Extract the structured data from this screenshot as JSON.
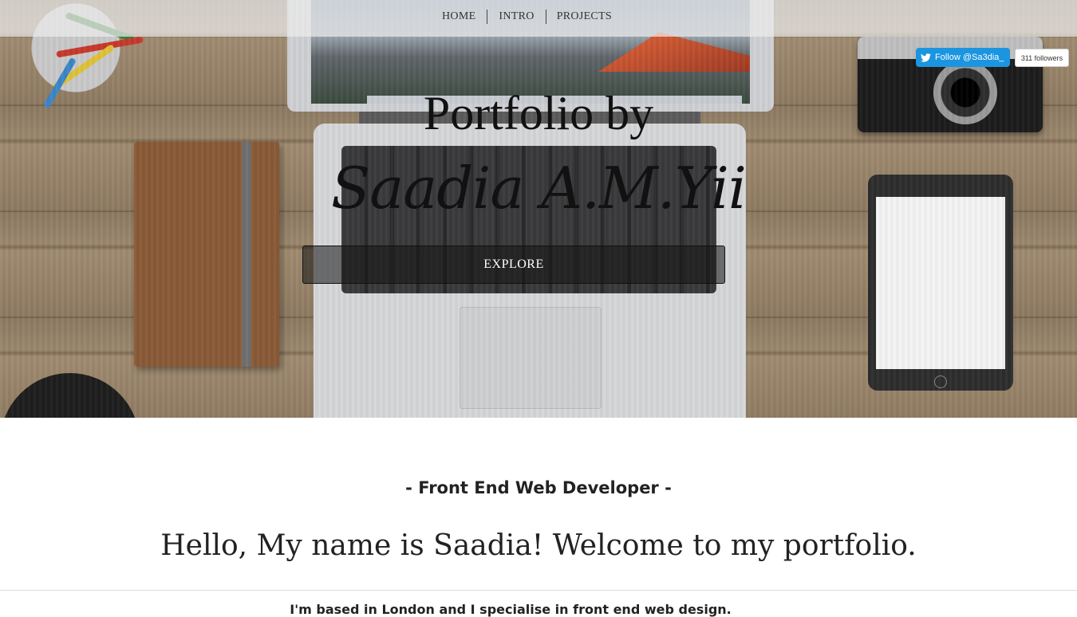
{
  "nav": {
    "items": [
      {
        "label": "HOME"
      },
      {
        "label": "INTRO"
      },
      {
        "label": "PROJECTS"
      }
    ]
  },
  "twitter": {
    "follow_label": "Follow @Sa3dia_",
    "followers_label": "311 followers",
    "brand_color": "#1b95e0"
  },
  "hero": {
    "title_line1": "Portfolio by",
    "title_line2": "Saadia A.M.Yii",
    "explore_label": "EXPLORE"
  },
  "intro": {
    "role": "- Front End Web Developer -",
    "greeting": "Hello, My name is Saadia! Welcome to my portfolio.",
    "based": "I'm based in London and I specialise in front end web design."
  }
}
